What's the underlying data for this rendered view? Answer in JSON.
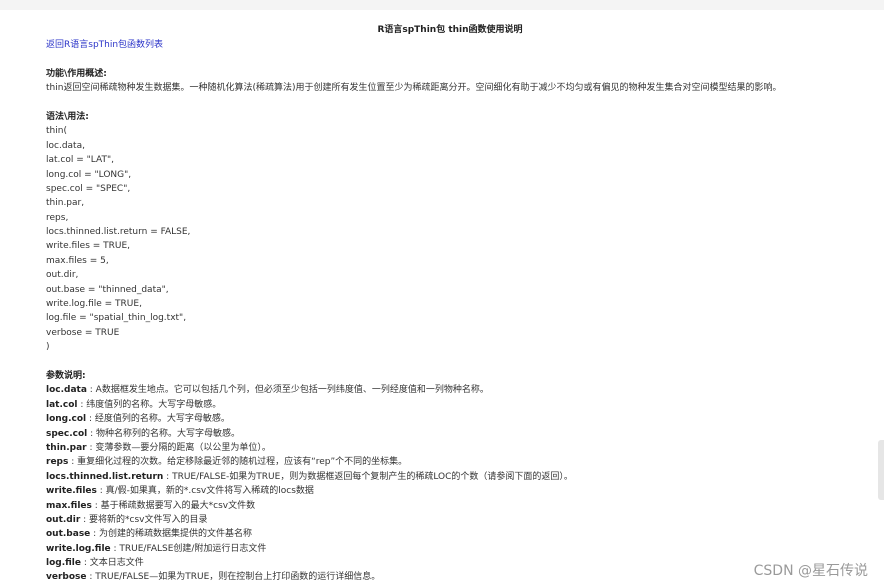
{
  "document": {
    "title": "R语言spThin包 thin函数使用说明",
    "back_link": "返回R语言spThin包函数列表",
    "function_heading": "功能\\作用概述:",
    "function_desc": "thin返回空间稀疏物种发生数据集。一种随机化算法(稀疏算法)用于创建所有发生位置至少为稀疏距离分开。空间细化有助于减少不均匀或有偏见的物种发生集合对空间模型结果的影响。",
    "syntax_heading": "语法\\用法:",
    "syntax_lines": [
      "thin(",
      "loc.data,",
      "lat.col = \"LAT\",",
      "long.col = \"LONG\",",
      "spec.col = \"SPEC\",",
      "thin.par,",
      "reps,",
      "locs.thinned.list.return = FALSE,",
      "write.files = TRUE,",
      "max.files = 5,",
      "out.dir,",
      "out.base = \"thinned_data\",",
      "write.log.file = TRUE,",
      "log.file = \"spatial_thin_log.txt\",",
      "verbose = TRUE",
      ")"
    ],
    "params_heading": "参数说明:",
    "params": [
      {
        "name": "loc.data",
        "desc": " : A数据框发生地点。它可以包括几个列，但必须至少包括一列纬度值、一列经度值和一列物种名称。"
      },
      {
        "name": "lat.col",
        "desc": " : 纬度值列的名称。大写字母敏感。"
      },
      {
        "name": "long.col",
        "desc": " : 经度值列的名称。大写字母敏感。"
      },
      {
        "name": "spec.col",
        "desc": " : 物种名称列的名称。大写字母敏感。"
      },
      {
        "name": "thin.par",
        "desc": " : 变薄参数—要分隔的距离（以公里为单位）。"
      },
      {
        "name": "reps",
        "desc": " : 重复细化过程的次数。给定移除最近邻的随机过程，应该有“rep”个不同的坐标集。"
      },
      {
        "name": "locs.thinned.list.return",
        "desc": " : TRUE/FALSE-如果为TRUE，则为数据框返回每个复制产生的稀疏LOC的个数（请参阅下面的返回）。"
      },
      {
        "name": "write.files",
        "desc": " : 真/假-如果真，新的*.csv文件将写入稀疏的locs数据"
      },
      {
        "name": "max.files",
        "desc": " : 基于稀疏数据要写入的最大*csv文件数"
      },
      {
        "name": "out.dir",
        "desc": " : 要将新的*csv文件写入的目录"
      },
      {
        "name": "out.base",
        "desc": " : 为创建的稀疏数据集提供的文件基名称"
      },
      {
        "name": "write.log.file",
        "desc": " : TRUE/FALSE创建/附加运行日志文件"
      },
      {
        "name": "log.file",
        "desc": " : 文本日志文件"
      },
      {
        "name": "verbose",
        "desc": " : TRUE/FALSE—如果为TRUE，则在控制台上打印函数的运行详细信息。"
      }
    ]
  },
  "watermark": "CSDN @星石传说",
  "colors": {
    "link": "#2a33c8",
    "text": "#333333",
    "watermark": "#9a9a9a"
  }
}
